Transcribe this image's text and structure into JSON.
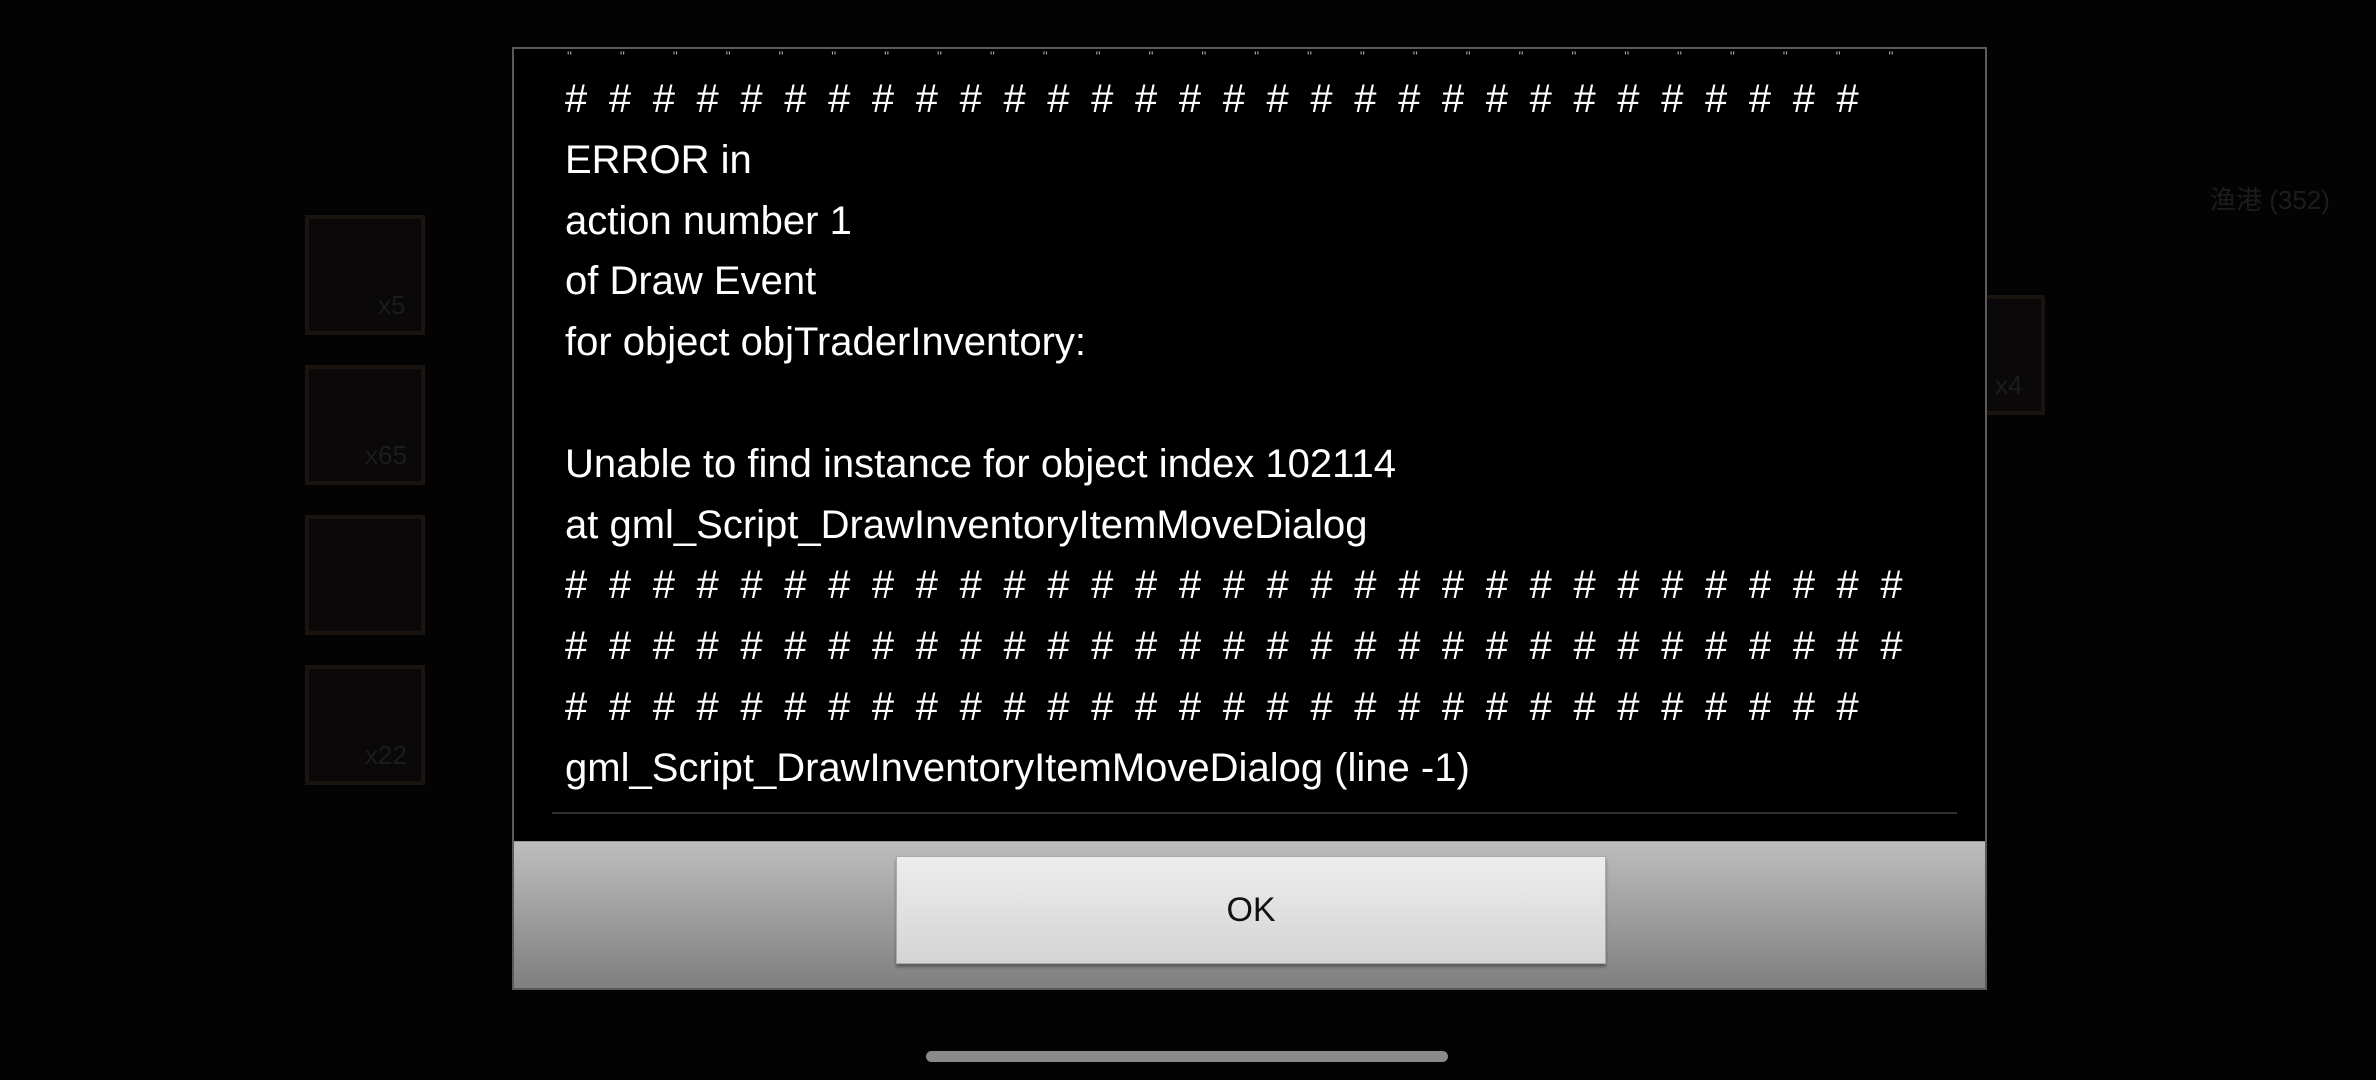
{
  "dialog": {
    "top_partial_line": "\" \" \" \" \" \" \" \" \" \" \" \" \" \" \" \" \" \" \" \" \" \" \" \" \" \" \" \" \" \" \"",
    "lines": [
      "##############################",
      "ERROR in",
      "action number 1",
      "of Draw Event",
      "for object objTraderInventory:",
      "",
      "Unable to find instance for object index 102114",
      "at gml_Script_DrawInventoryItemMoveDialog",
      "###############################",
      "###############################",
      "##############################",
      "gml_Script_DrawInventoryItemMoveDialog (line -1)"
    ],
    "ok_label": "OK"
  },
  "background": {
    "top_right_label": "渔港 (352)",
    "slot_counts": [
      "x5",
      "x65",
      "x22",
      "x4"
    ]
  }
}
